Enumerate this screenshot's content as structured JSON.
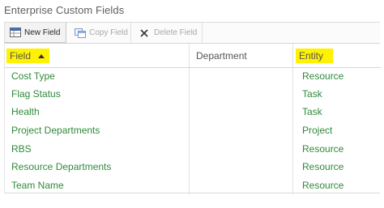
{
  "page": {
    "title": "Enterprise Custom Fields"
  },
  "toolbar": {
    "new_field": "New Field",
    "copy_field": "Copy Field",
    "delete_field": "Delete Field"
  },
  "grid": {
    "columns": [
      {
        "label": "Field",
        "sorted": "ascending",
        "highlighted": true
      },
      {
        "label": "Department",
        "highlighted": false
      },
      {
        "label": "Entity",
        "highlighted": true
      }
    ],
    "rows": [
      {
        "field": "Cost Type",
        "department": "",
        "entity": "Resource"
      },
      {
        "field": "Flag Status",
        "department": "",
        "entity": "Task"
      },
      {
        "field": "Health",
        "department": "",
        "entity": "Task"
      },
      {
        "field": "Project Departments",
        "department": "",
        "entity": "Project"
      },
      {
        "field": "RBS",
        "department": "",
        "entity": "Resource"
      },
      {
        "field": "Resource Departments",
        "department": "",
        "entity": "Resource"
      },
      {
        "field": "Team Name",
        "department": "",
        "entity": "Resource"
      }
    ]
  },
  "colors": {
    "link_text": "#2f8a3a",
    "highlight": "#fff200",
    "disabled_text": "#a8a8a8"
  }
}
